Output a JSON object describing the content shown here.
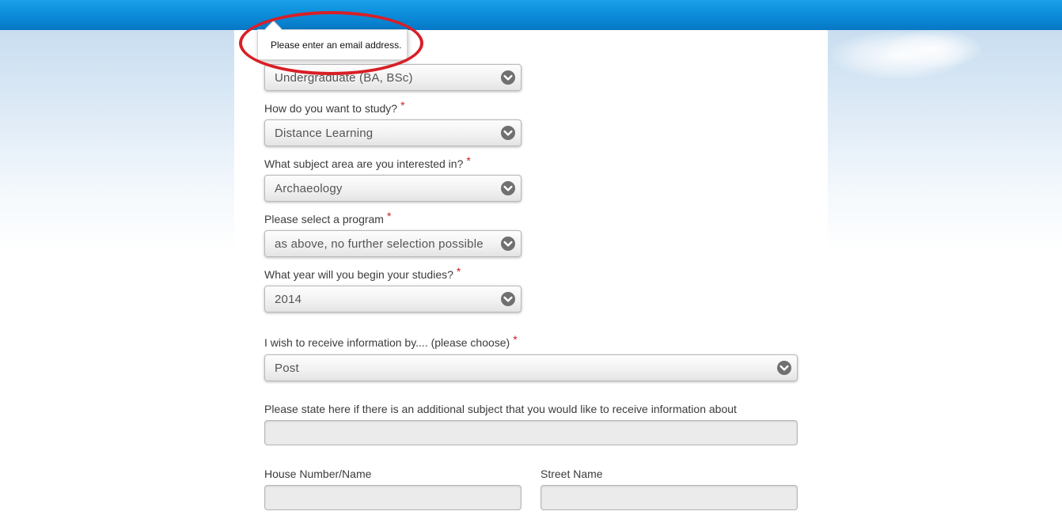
{
  "tooltip": {
    "message": "Please enter an email address."
  },
  "form": {
    "study_level": {
      "value": "Undergraduate (BA, BSc)"
    },
    "study_mode": {
      "label": "How do you want to study?",
      "required": "*",
      "value": "Distance Learning"
    },
    "subject_area": {
      "label": "What subject area are you interested in?",
      "required": "*",
      "value": "Archaeology"
    },
    "program": {
      "label": "Please select a program",
      "required": "*",
      "value": "as above, no further selection possible"
    },
    "start_year": {
      "label": "What year will you begin your studies?",
      "required": "*",
      "value": "2014"
    },
    "info_method": {
      "label": "I wish to receive information by.... (please choose)",
      "required": "*",
      "value": "Post"
    },
    "additional_subject": {
      "label": "Please state here if there is an additional subject that you would like to receive information about",
      "value": ""
    },
    "house_number": {
      "label": "House Number/Name",
      "value": ""
    },
    "street_name": {
      "label": "Street Name",
      "value": ""
    }
  },
  "colors": {
    "header": "#0a8ad8",
    "required_star": "#cc1f1f",
    "annotation_circle": "#d81f26"
  },
  "icons": {
    "dropdown": "chevron-down-circle-icon"
  }
}
